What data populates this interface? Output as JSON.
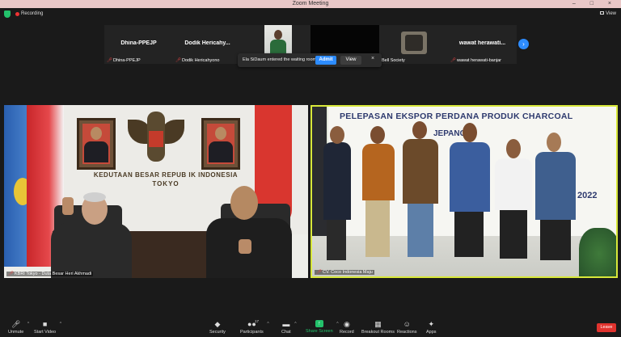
{
  "window": {
    "title": "Zoom Meeting",
    "controls": "– □ ×"
  },
  "topbar": {
    "recording_label": "Recording",
    "view_label": "View"
  },
  "participants_strip": [
    {
      "display_name": "Dhina-PPEJP",
      "label": "Dhina-PPEJP",
      "video": false
    },
    {
      "display_name": "Dodik Hericahy...",
      "label": "Dodik Hericahyono",
      "video": false
    },
    {
      "display_name": "",
      "label": "",
      "video": true
    },
    {
      "display_name": "",
      "label": "",
      "video": false
    },
    {
      "display_name": "",
      "label": "Bell Society",
      "video": true
    },
    {
      "display_name": "wawat herawati...",
      "label": "wawat herawati-banjar",
      "video": false
    }
  ],
  "waiting_room": {
    "message": "Ela SiDaum entered the waiting room",
    "admit_label": "Admit",
    "view_label": "View",
    "close_glyph": "×"
  },
  "main_videos": {
    "left": {
      "label": "KBRI Tokyo - Duta Besar Heri Akhmadi",
      "wall_text_line1": "KEDUTAAN BESAR REPUB IK INDONESIA",
      "wall_text_line2": "TOKYO"
    },
    "right": {
      "label": "CV. Coco Indonesia Maju",
      "banner_line1": "PELEPASAN EKSPOR PERDANA PRODUK CHARCOAL",
      "banner_line2": "JEPANG",
      "banner_year": "2022"
    }
  },
  "toolbar": {
    "unmute_label": "Unmute",
    "start_video_label": "Start Video",
    "security_label": "Security",
    "participants_label": "Participants",
    "participants_count": "17",
    "chat_label": "Chat",
    "share_screen_label": "Share Screen",
    "record_label": "Record",
    "breakout_label": "Breakout Rooms",
    "reactions_label": "Reactions",
    "apps_label": "Apps",
    "leave_label": "Leave"
  },
  "colors": {
    "accent": "#2d8cff",
    "share_green": "#23c16b",
    "leave_red": "#e0332e",
    "active_speaker_border": "#d8e83a"
  }
}
